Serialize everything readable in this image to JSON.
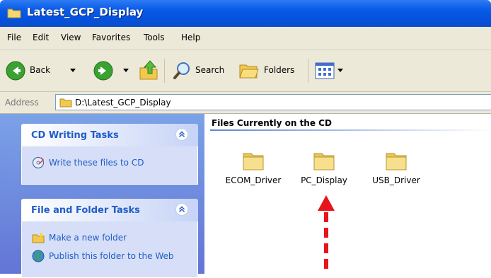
{
  "window": {
    "title": "Latest_GCP_Display"
  },
  "menu": [
    "File",
    "Edit",
    "View",
    "Favorites",
    "Tools",
    "Help"
  ],
  "toolbar": {
    "back_label": "Back",
    "search_label": "Search",
    "folders_label": "Folders"
  },
  "address": {
    "label": "Address",
    "path": "D:\\Latest_GCP_Display"
  },
  "left_pane": {
    "cd_writing": {
      "title": "CD Writing Tasks",
      "tasks": [
        "Write these files to CD"
      ]
    },
    "file_folder": {
      "title": "File and Folder Tasks",
      "tasks": [
        "Make a new folder",
        "Publish this folder to the Web"
      ]
    }
  },
  "content": {
    "group_title": "Files Currently on the CD",
    "folders": [
      "ECOM_Driver",
      "PC_Display",
      "USB_Driver"
    ]
  },
  "colors": {
    "title_bar": "#0a5ce6",
    "left_pane": "#6f8fde",
    "task_link": "#215dc6",
    "arrow": "#e8141c"
  }
}
